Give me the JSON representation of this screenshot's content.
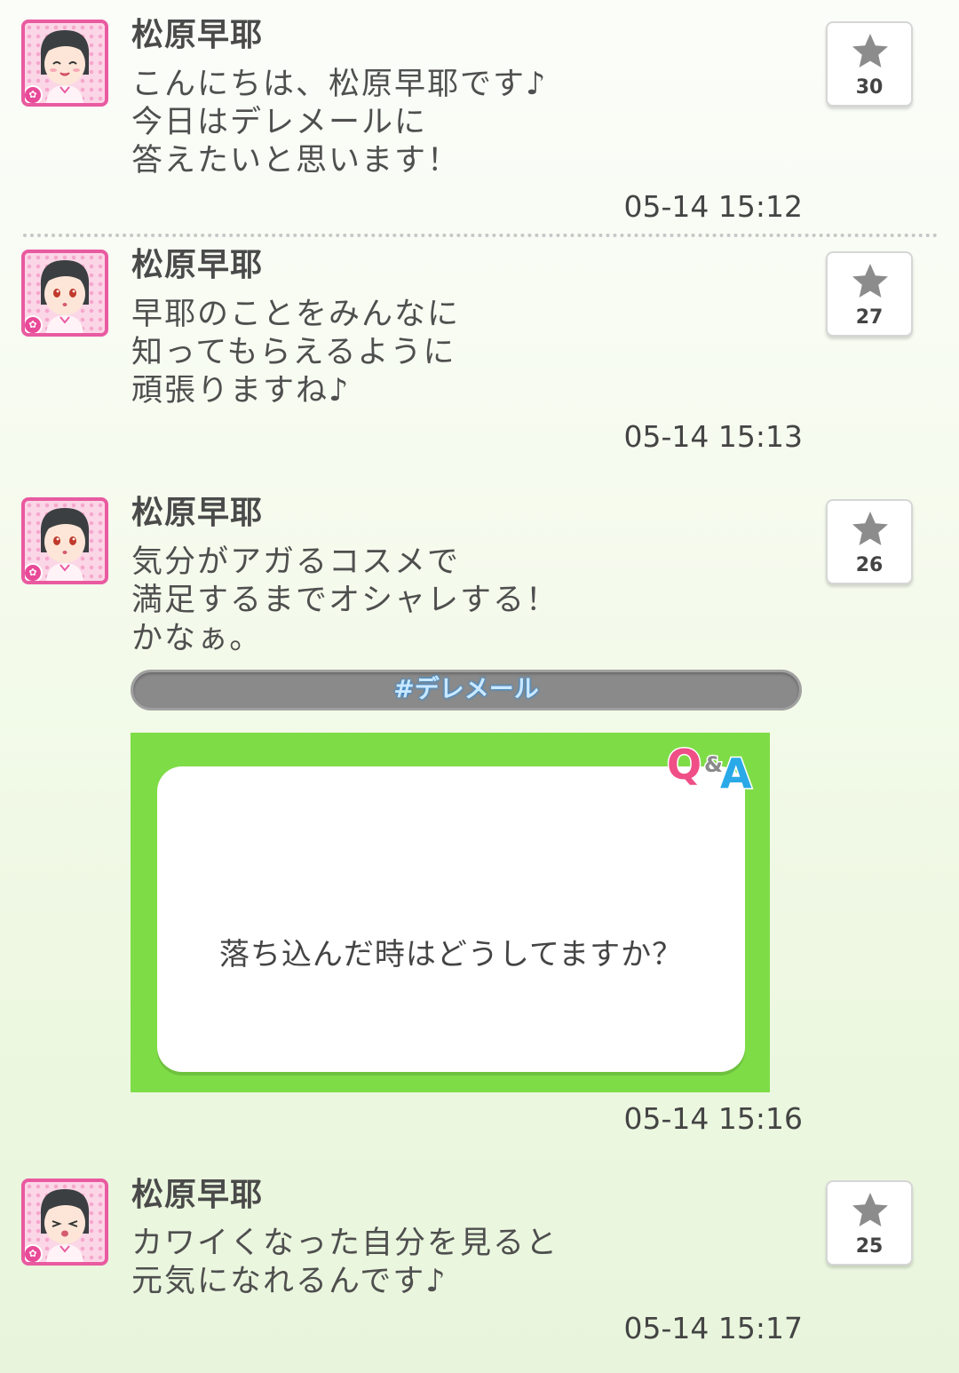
{
  "posts": [
    {
      "author": "松原早耶",
      "message": "こんにちは、松原早耶です♪\n今日はデレメールに\n答えたいと思います！",
      "timestamp": "05-14 15:12",
      "likes": "30"
    },
    {
      "author": "松原早耶",
      "message": "早耶のことをみんなに\n知ってもらえるように\n頑張りますね♪",
      "timestamp": "05-14 15:13",
      "likes": "27"
    },
    {
      "author": "松原早耶",
      "message": "気分がアガるコスメで\n満足するまでオシャレする！\nかなぁ。",
      "timestamp": "05-14 15:16",
      "likes": "26",
      "hashtag": "#デレメール",
      "qa": {
        "logo_q": "Q",
        "logo_amp": "&",
        "logo_a": "A",
        "question": "落ち込んだ時はどうしてますか？"
      }
    },
    {
      "author": "松原早耶",
      "message": "カワイくなった自分を見ると\n元気になれるんです♪",
      "timestamp": "05-14 15:17",
      "likes": "25"
    }
  ],
  "colors": {
    "avatar_border": "#e95aa0",
    "qa_card": "#7edc47",
    "hashtag_bg": "#8a8a8a",
    "star": "#8c8c8c"
  },
  "icons": {
    "avatar": "character-avatar-icon",
    "like": "star-icon",
    "badge": "flower-icon"
  }
}
